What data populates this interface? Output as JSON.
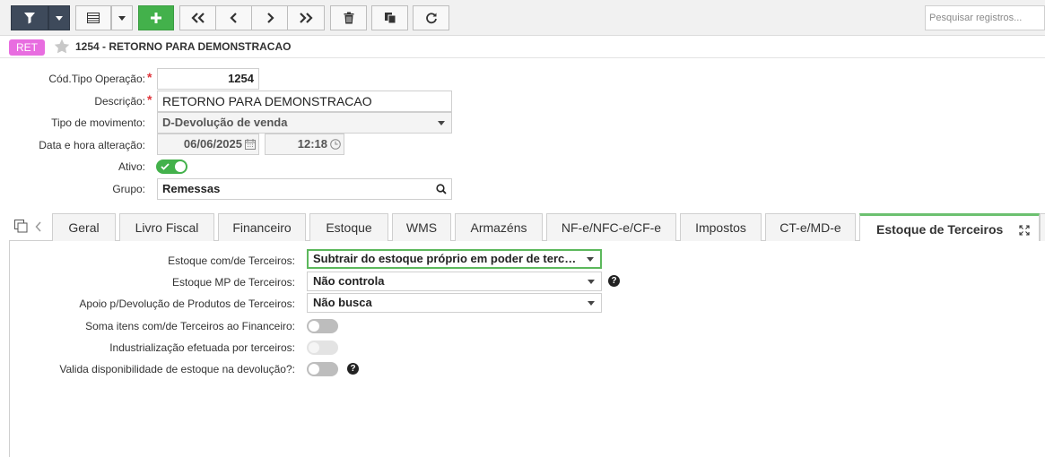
{
  "toolbar": {
    "search_placeholder": "Pesquisar registros..."
  },
  "header": {
    "badge": "RET",
    "title": "1254 - RETORNO PARA DEMONSTRACAO"
  },
  "form": {
    "cod_label": "Cód.Tipo Operação:",
    "cod_value": "1254",
    "desc_label": "Descrição:",
    "desc_value": "RETORNO PARA DEMONSTRACAO",
    "tipo_label": "Tipo de movimento:",
    "tipo_value": "D-Devolução de venda",
    "data_label": "Data e hora alteração:",
    "data_value": "06/06/2025",
    "hora_value": "12:18",
    "ativo_label": "Ativo:",
    "ativo": true,
    "grupo_label": "Grupo:",
    "grupo_value": "Remessas",
    "required_mark": "*"
  },
  "tabs": [
    "Geral",
    "Livro Fiscal",
    "Financeiro",
    "Estoque",
    "WMS",
    "Armazéns",
    "NF-e/NFC-e/CF-e",
    "Impostos",
    "CT-e/MD-e",
    "Estoque de Terceiros"
  ],
  "active_tab": "Estoque de Terceiros",
  "terceiros": {
    "estoque_label": "Estoque com/de Terceiros:",
    "estoque_value": "Subtrair do estoque próprio em poder de terceiros",
    "mp_label": "Estoque MP de Terceiros:",
    "mp_value": "Não controla",
    "apoio_label": "Apoio p/Devolução de Produtos de Terceiros:",
    "apoio_value": "Não busca",
    "soma_label": "Soma itens com/de Terceiros ao Financeiro:",
    "soma": false,
    "indust_label": "Industrialização efetuada por terceiros:",
    "indust": false,
    "valida_label": "Valida disponibilidade de estoque na devolução?:",
    "valida": false,
    "help_glyph": "?"
  },
  "colors": {
    "toolbar_dark": "#3e4a5b",
    "add_green": "#43b14b",
    "badge_pink": "#e86de0",
    "required_red": "#e0353b",
    "focus_green": "#5cb85c"
  }
}
